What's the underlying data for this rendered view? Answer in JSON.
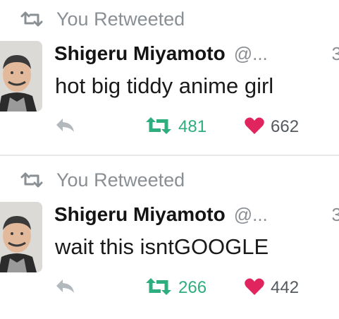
{
  "tweets": [
    {
      "context": "You Retweeted",
      "author_name": "Shigeru Miyamoto",
      "handle": "@...",
      "time": "3",
      "text": "hot big tiddy anime girl",
      "retweet_count": "481",
      "like_count": "662"
    },
    {
      "context": "You Retweeted",
      "author_name": "Shigeru Miyamoto",
      "handle": "@...",
      "time": "3",
      "text": "wait this isntGOOGLE",
      "retweet_count": "266",
      "like_count": "442"
    }
  ],
  "colors": {
    "retweet_green": "#2eae7e",
    "heart_red": "#e0245e",
    "muted_gray": "#8a8f94"
  },
  "icons": [
    "retweet-icon",
    "reply-icon",
    "heart-icon"
  ]
}
